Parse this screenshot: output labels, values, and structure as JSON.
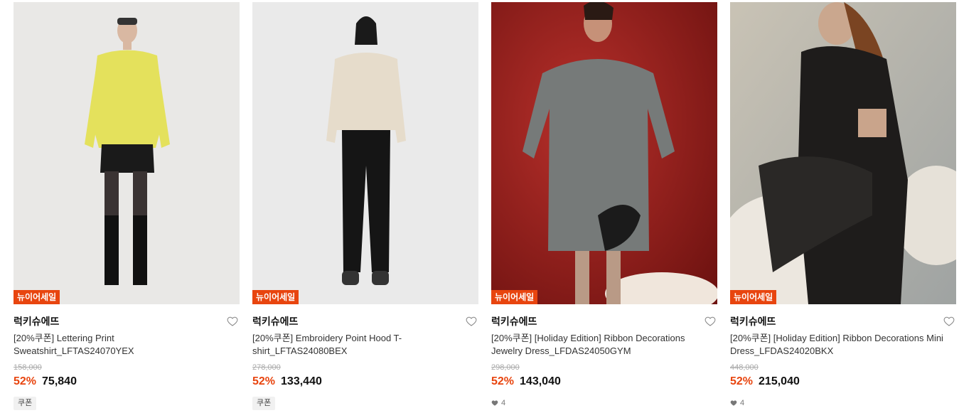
{
  "products": [
    {
      "badge": "뉴이어세일",
      "brand": "럭키슈에뜨",
      "title": "[20%쿠폰] Lettering Print Sweatshirt_LFTAS24070YEX",
      "original_price": "158,000",
      "discount": "52%",
      "price": "75,840",
      "chip": "쿠폰",
      "likes": "",
      "bg": "#e9e8e6"
    },
    {
      "badge": "뉴이어세일",
      "brand": "럭키슈에뜨",
      "title": "[20%쿠폰] Embroidery Point Hood T-shirt_LFTAS24080BEX",
      "original_price": "278,000",
      "discount": "52%",
      "price": "133,440",
      "chip": "쿠폰",
      "likes": "",
      "bg": "#eaeaea"
    },
    {
      "badge": "뉴이어세일",
      "brand": "럭키슈에뜨",
      "title": "[20%쿠폰] [Holiday Edition] Ribbon Decorations Jewelry Dress_LFDAS24050GYM",
      "original_price": "298,000",
      "discount": "52%",
      "price": "143,040",
      "chip": "",
      "likes": "4",
      "bg": "#9a1d1a"
    },
    {
      "badge": "뉴이어세일",
      "brand": "럭키슈에뜨",
      "title": "[20%쿠폰] [Holiday Edition] Ribbon Decorations Mini Dress_LFDAS24020BKX",
      "original_price": "448,000",
      "discount": "52%",
      "price": "215,040",
      "chip": "",
      "likes": "4",
      "bg": "#b9b8b0"
    }
  ]
}
